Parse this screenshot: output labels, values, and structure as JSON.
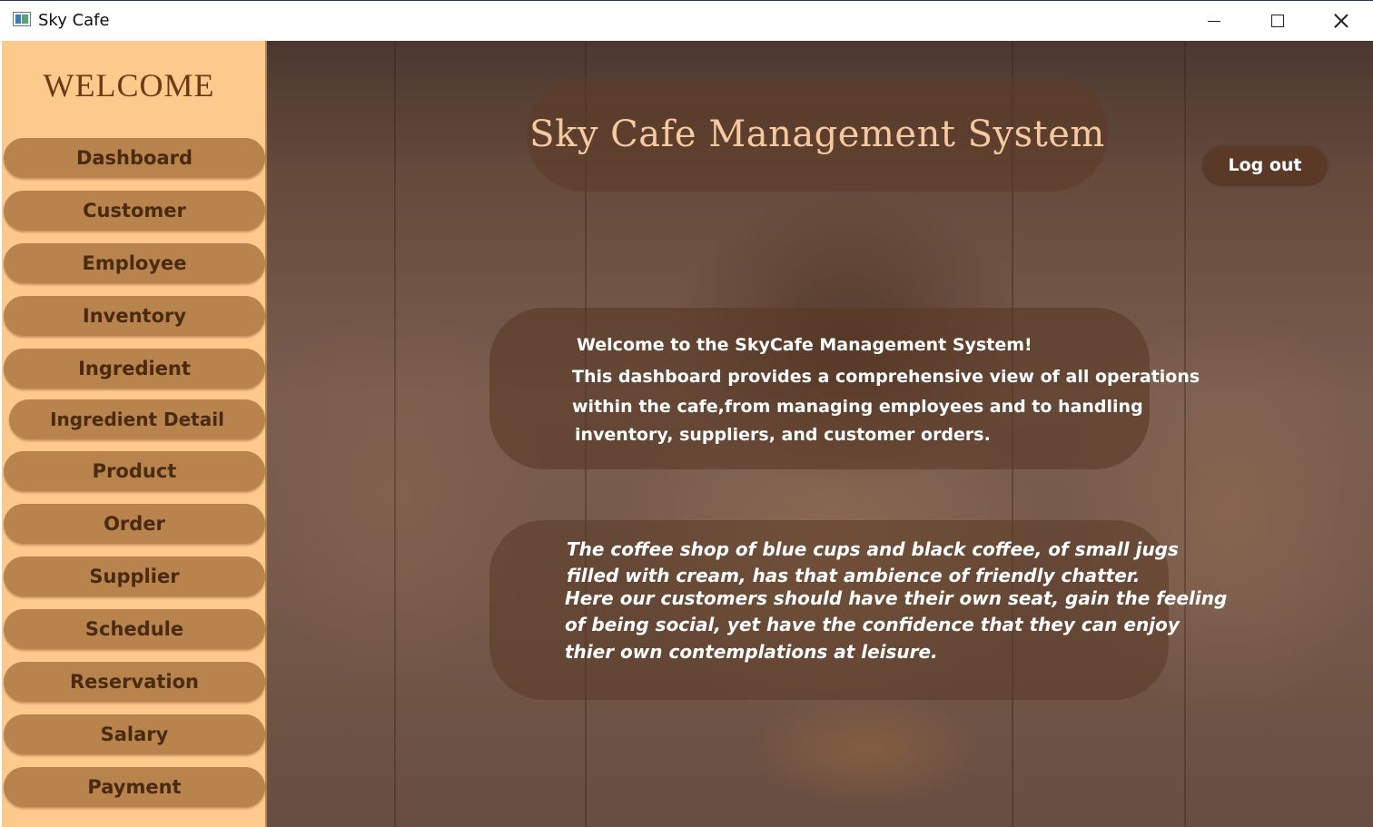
{
  "window": {
    "title": "Sky Cafe",
    "minimize_icon": "minimize-icon",
    "maximize_icon": "maximize-icon",
    "close_icon": "close-icon"
  },
  "sidebar": {
    "heading": "WELCOME",
    "items": [
      {
        "label": "Dashboard"
      },
      {
        "label": "Customer"
      },
      {
        "label": "Employee"
      },
      {
        "label": "Inventory"
      },
      {
        "label": "Ingredient"
      },
      {
        "label": "Ingredient Detail"
      },
      {
        "label": "Product"
      },
      {
        "label": "Order"
      },
      {
        "label": "Supplier"
      },
      {
        "label": "Schedule"
      },
      {
        "label": "Reservation"
      },
      {
        "label": "Salary"
      },
      {
        "label": "Payment"
      }
    ]
  },
  "main": {
    "title": "Sky Cafe Management System",
    "logout_label": "Log out",
    "info_lines": [
      "Welcome to the SkyCafe Management System!",
      "This dashboard provides a comprehensive view of all operations",
      "within the cafe,from managing employees and to handling",
      "inventory, suppliers, and customer orders."
    ],
    "quote_lines": [
      "The coffee shop of blue cups and black coffee, of small jugs",
      "filled with cream, has that ambience of friendly chatter.",
      "Here our customers should have their own seat, gain the feeling",
      "of being social, yet have the confidence that they can enjoy",
      "thier own contemplations at leisure."
    ]
  },
  "colors": {
    "sidebar_bg": "#fec98d",
    "nav_button": "#b8834c",
    "nav_text": "#4a2a10",
    "title_text": "#f6caa0",
    "logout_bg": "#5a3a26"
  }
}
